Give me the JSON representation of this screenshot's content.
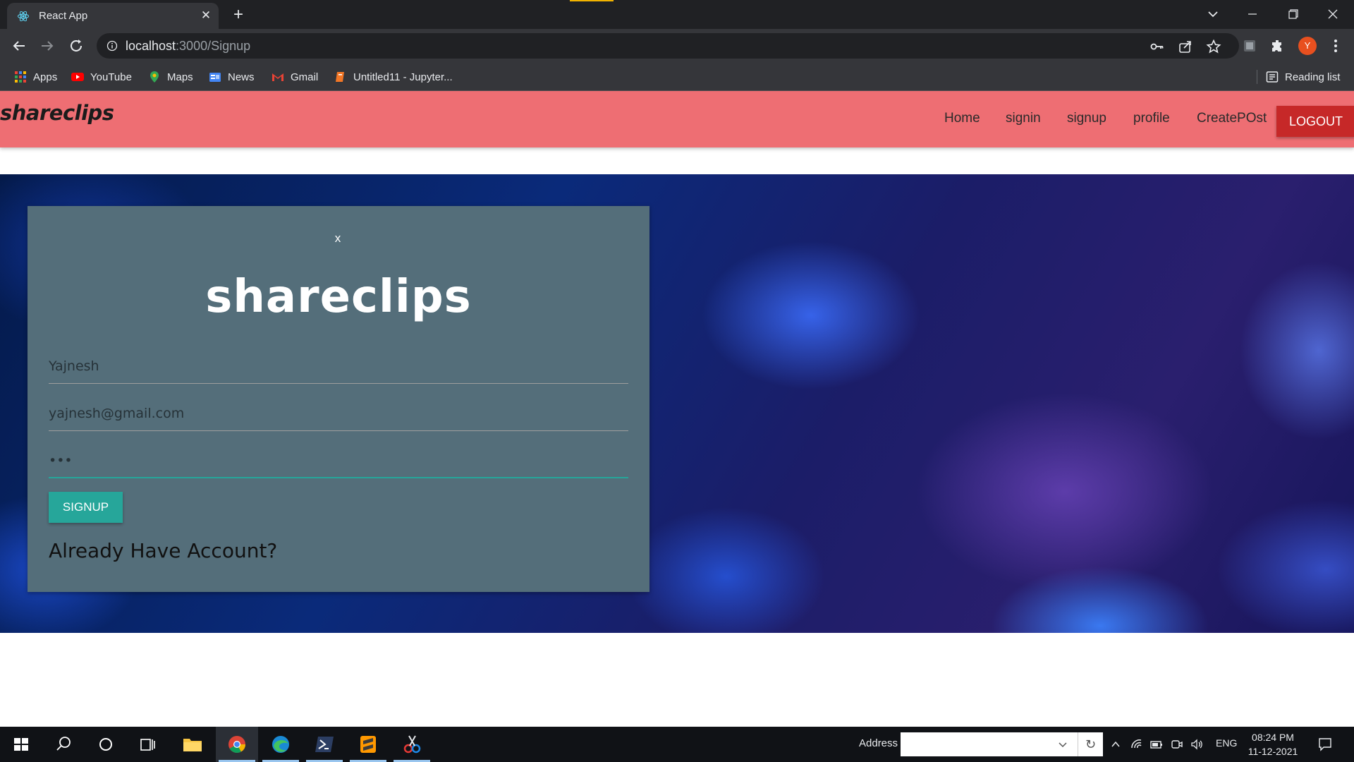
{
  "browser": {
    "tab_title": "React App",
    "url_host": "localhost",
    "url_path": ":3000/Signup",
    "profile_initial": "Y",
    "bookmarks": [
      {
        "label": "Apps",
        "icon": "apps-grid-icon"
      },
      {
        "label": "YouTube",
        "icon": "youtube-icon"
      },
      {
        "label": "Maps",
        "icon": "maps-icon"
      },
      {
        "label": "News",
        "icon": "news-icon"
      },
      {
        "label": "Gmail",
        "icon": "gmail-icon"
      },
      {
        "label": "Untitled11 - Jupyter...",
        "icon": "jupyter-icon"
      }
    ],
    "reading_list_label": "Reading list"
  },
  "app": {
    "brand": "shareclips",
    "nav_links": [
      "Home",
      "signin",
      "signup",
      "profile",
      "CreatePOst"
    ],
    "logout_label": "LOGOUT"
  },
  "signup_card": {
    "close_label": "x",
    "logo": "shareclips",
    "name_value": "Yajnesh",
    "email_value": "yajnesh@gmail.com",
    "password_value": "•••",
    "signup_label": "SIGNUP",
    "already_label": "Already Have Account?"
  },
  "taskbar": {
    "address_label": "Address",
    "language": "ENG",
    "time": "08:24 PM",
    "date": "11-12-2021"
  },
  "colors": {
    "navbar": "#ee6e73",
    "logout": "#c62828",
    "card": "#546e7a",
    "signup_button": "#26a69a"
  }
}
